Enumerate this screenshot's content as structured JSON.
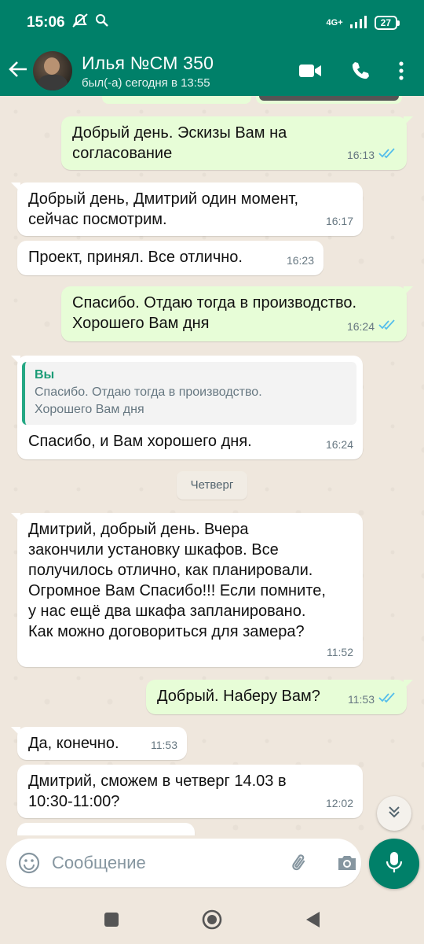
{
  "status_bar": {
    "time": "15:06",
    "network": "4G+",
    "battery": "27"
  },
  "header": {
    "contact_name": "Илья №СМ 350",
    "last_seen": "был(-а) сегодня в 13:55"
  },
  "messages": [
    {
      "dir": "out",
      "text": "Добрый день. Эскизы Вам на\nсогласование",
      "time": "16:13",
      "read": true
    },
    {
      "dir": "in",
      "text": "Добрый день, Дмитрий один момент,\nсейчас посмотрим.",
      "time": "16:17"
    },
    {
      "dir": "in",
      "text": "Проект, принял. Все отлично.",
      "time": "16:23"
    },
    {
      "dir": "out",
      "text": "Спасибо. Отдаю тогда в производство.\nХорошего Вам дня",
      "time": "16:24",
      "read": true
    },
    {
      "dir": "in",
      "quote_author": "Вы",
      "quote_text": "Спасибо. Отдаю тогда в производство.\nХорошего Вам дня",
      "text": "Спасибо, и Вам хорошего дня.",
      "time": "16:24"
    },
    {
      "dir": "in",
      "text": "Дмитрий, добрый день. Вчера\nзакончили установку шкафов. Все\nполучилось отлично, как планировали.\nОгромное Вам Спасибо!!! Если помните,\nу нас ещё два шкафа запланировано.\nКак можно договориться для замера?",
      "time": "11:52"
    },
    {
      "dir": "out",
      "text": "Добрый. Наберу Вам?",
      "time": "11:53",
      "read": true
    },
    {
      "dir": "in",
      "text": "Да, конечно.",
      "time": "11:53"
    },
    {
      "dir": "in",
      "text": "Дмитрий, сможем в четверг 14.03 в\n10:30-11:00?",
      "time": "12:02"
    }
  ],
  "date_divider": "Четверг",
  "composer": {
    "placeholder": "Сообщение"
  },
  "icons": {
    "back": "arrow-left-icon",
    "video": "video-call-icon",
    "call": "phone-icon",
    "menu": "more-vert-icon",
    "emoji": "emoji-icon",
    "attach": "paperclip-icon",
    "camera": "camera-icon",
    "mic": "mic-icon",
    "scroll": "double-chevron-down-icon"
  },
  "colors": {
    "header": "#008069",
    "outgoing_bubble": "#e7fdd7",
    "incoming_bubble": "#ffffff",
    "read_ticks": "#53bdeb",
    "accent": "#25a884"
  }
}
